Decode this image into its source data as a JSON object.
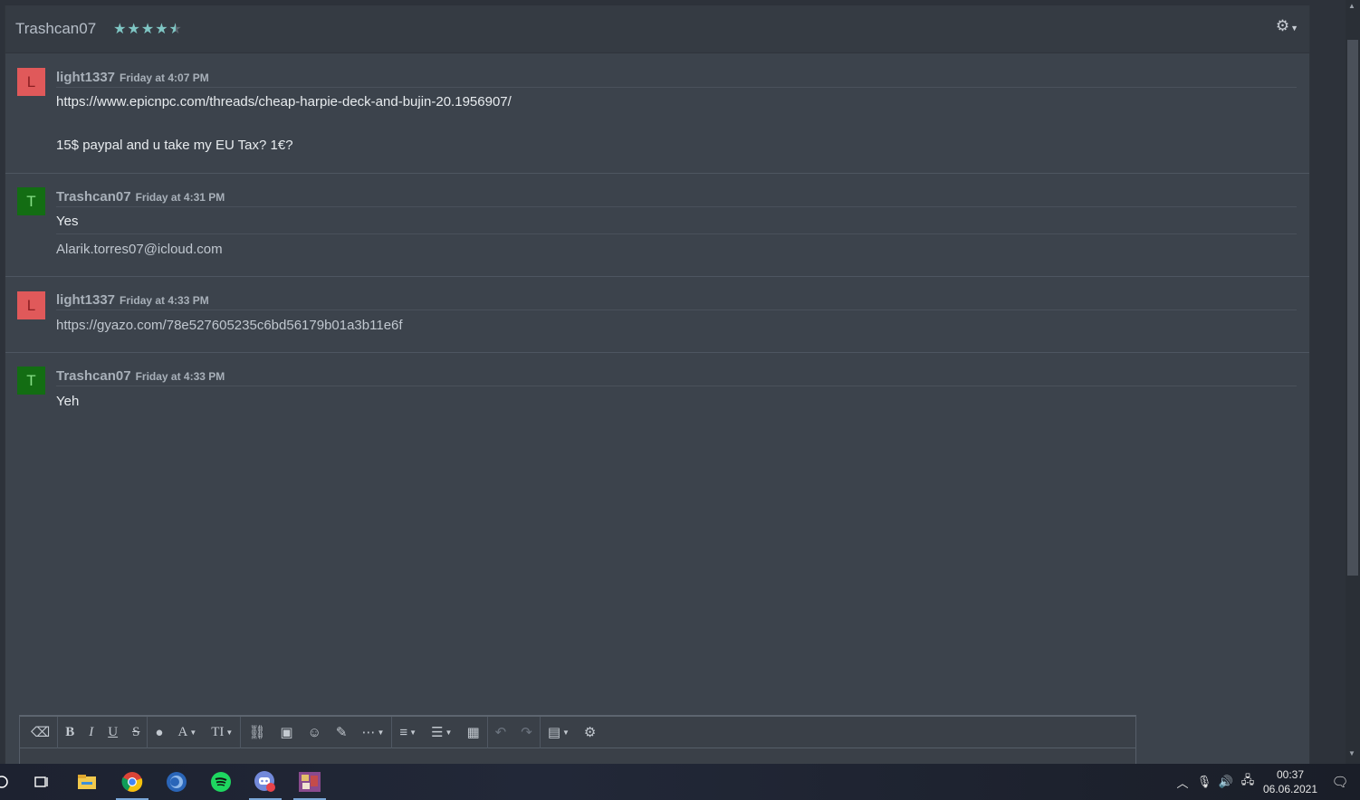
{
  "header": {
    "partner_name": "Trashcan07",
    "rating_stars": 4.5,
    "settings_icon": "gear-icon"
  },
  "messages": [
    {
      "author": "light1337",
      "time": "Friday at 4:07 PM",
      "avatar_letter": "L",
      "lines": [
        "https://www.epicnpc.com/threads/cheap-harpie-deck-and-bujin-20.1956907/",
        "15$ paypal and u take my EU Tax? 1€?"
      ]
    },
    {
      "author": "Trashcan07",
      "time": "Friday at 4:31 PM",
      "avatar_letter": "T",
      "lines": [
        "Yes",
        "Alarik.torres07@icloud.com"
      ]
    },
    {
      "author": "light1337",
      "time": "Friday at 4:33 PM",
      "avatar_letter": "L",
      "lines": [
        "https://gyazo.com/78e527605235c6bd56179b01a3b11e6f"
      ]
    },
    {
      "author": "Trashcan07",
      "time": "Friday at 4:33 PM",
      "avatar_letter": "T",
      "lines": [
        "Yeh"
      ]
    }
  ],
  "editor": {
    "toolbar_icons": [
      "eraser-icon",
      "bold-icon",
      "italic-icon",
      "underline-icon",
      "strikethrough-icon",
      "color-icon",
      "font-family-icon",
      "font-size-icon",
      "link-icon",
      "image-icon",
      "smiley-icon",
      "media-icon",
      "insert-more-icon",
      "align-icon",
      "list-icon",
      "table-icon",
      "undo-icon",
      "redo-icon",
      "drafts-icon",
      "options-icon"
    ]
  },
  "taskbar": {
    "apps": [
      "search-icon",
      "task-view-icon",
      "file-explorer-icon",
      "chrome-icon",
      "app-blue-icon",
      "spotify-icon",
      "discord-icon",
      "game-icon"
    ],
    "clock_time": "00:37",
    "clock_date": "06.06.2021"
  },
  "colors": {
    "panel_bg": "#3c434c",
    "avatar_l": "#e0595a",
    "avatar_t": "#136d13",
    "star": "#7fc6c4"
  }
}
